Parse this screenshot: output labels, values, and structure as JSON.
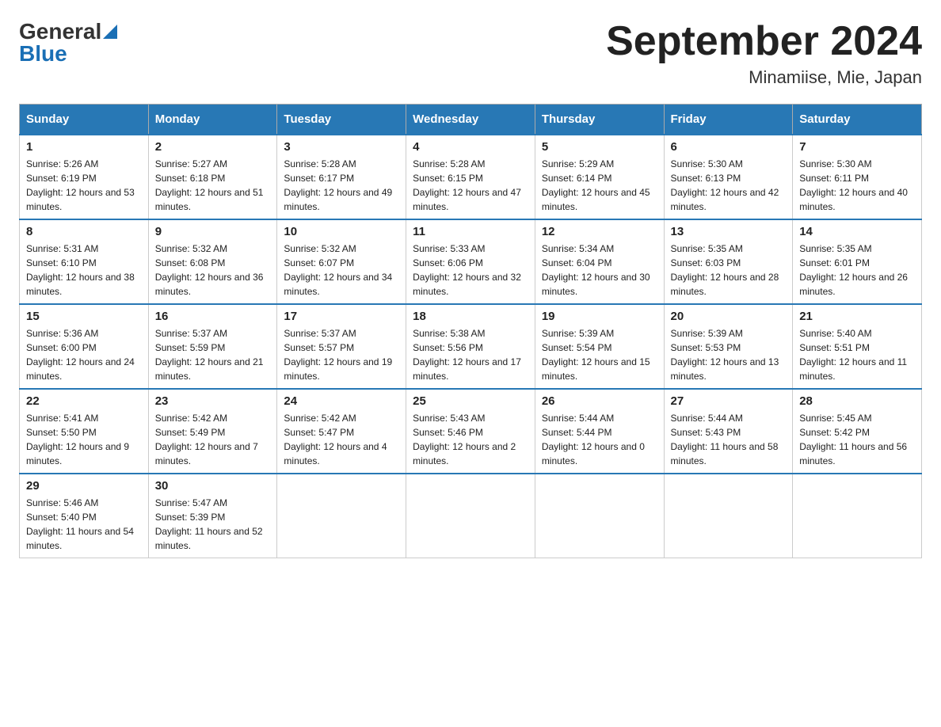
{
  "logo": {
    "text_general": "General",
    "text_blue": "Blue",
    "tagline": ""
  },
  "title": "September 2024",
  "subtitle": "Minamiise, Mie, Japan",
  "days_of_week": [
    "Sunday",
    "Monday",
    "Tuesday",
    "Wednesday",
    "Thursday",
    "Friday",
    "Saturday"
  ],
  "weeks": [
    [
      {
        "day": "1",
        "sunrise": "Sunrise: 5:26 AM",
        "sunset": "Sunset: 6:19 PM",
        "daylight": "Daylight: 12 hours and 53 minutes."
      },
      {
        "day": "2",
        "sunrise": "Sunrise: 5:27 AM",
        "sunset": "Sunset: 6:18 PM",
        "daylight": "Daylight: 12 hours and 51 minutes."
      },
      {
        "day": "3",
        "sunrise": "Sunrise: 5:28 AM",
        "sunset": "Sunset: 6:17 PM",
        "daylight": "Daylight: 12 hours and 49 minutes."
      },
      {
        "day": "4",
        "sunrise": "Sunrise: 5:28 AM",
        "sunset": "Sunset: 6:15 PM",
        "daylight": "Daylight: 12 hours and 47 minutes."
      },
      {
        "day": "5",
        "sunrise": "Sunrise: 5:29 AM",
        "sunset": "Sunset: 6:14 PM",
        "daylight": "Daylight: 12 hours and 45 minutes."
      },
      {
        "day": "6",
        "sunrise": "Sunrise: 5:30 AM",
        "sunset": "Sunset: 6:13 PM",
        "daylight": "Daylight: 12 hours and 42 minutes."
      },
      {
        "day": "7",
        "sunrise": "Sunrise: 5:30 AM",
        "sunset": "Sunset: 6:11 PM",
        "daylight": "Daylight: 12 hours and 40 minutes."
      }
    ],
    [
      {
        "day": "8",
        "sunrise": "Sunrise: 5:31 AM",
        "sunset": "Sunset: 6:10 PM",
        "daylight": "Daylight: 12 hours and 38 minutes."
      },
      {
        "day": "9",
        "sunrise": "Sunrise: 5:32 AM",
        "sunset": "Sunset: 6:08 PM",
        "daylight": "Daylight: 12 hours and 36 minutes."
      },
      {
        "day": "10",
        "sunrise": "Sunrise: 5:32 AM",
        "sunset": "Sunset: 6:07 PM",
        "daylight": "Daylight: 12 hours and 34 minutes."
      },
      {
        "day": "11",
        "sunrise": "Sunrise: 5:33 AM",
        "sunset": "Sunset: 6:06 PM",
        "daylight": "Daylight: 12 hours and 32 minutes."
      },
      {
        "day": "12",
        "sunrise": "Sunrise: 5:34 AM",
        "sunset": "Sunset: 6:04 PM",
        "daylight": "Daylight: 12 hours and 30 minutes."
      },
      {
        "day": "13",
        "sunrise": "Sunrise: 5:35 AM",
        "sunset": "Sunset: 6:03 PM",
        "daylight": "Daylight: 12 hours and 28 minutes."
      },
      {
        "day": "14",
        "sunrise": "Sunrise: 5:35 AM",
        "sunset": "Sunset: 6:01 PM",
        "daylight": "Daylight: 12 hours and 26 minutes."
      }
    ],
    [
      {
        "day": "15",
        "sunrise": "Sunrise: 5:36 AM",
        "sunset": "Sunset: 6:00 PM",
        "daylight": "Daylight: 12 hours and 24 minutes."
      },
      {
        "day": "16",
        "sunrise": "Sunrise: 5:37 AM",
        "sunset": "Sunset: 5:59 PM",
        "daylight": "Daylight: 12 hours and 21 minutes."
      },
      {
        "day": "17",
        "sunrise": "Sunrise: 5:37 AM",
        "sunset": "Sunset: 5:57 PM",
        "daylight": "Daylight: 12 hours and 19 minutes."
      },
      {
        "day": "18",
        "sunrise": "Sunrise: 5:38 AM",
        "sunset": "Sunset: 5:56 PM",
        "daylight": "Daylight: 12 hours and 17 minutes."
      },
      {
        "day": "19",
        "sunrise": "Sunrise: 5:39 AM",
        "sunset": "Sunset: 5:54 PM",
        "daylight": "Daylight: 12 hours and 15 minutes."
      },
      {
        "day": "20",
        "sunrise": "Sunrise: 5:39 AM",
        "sunset": "Sunset: 5:53 PM",
        "daylight": "Daylight: 12 hours and 13 minutes."
      },
      {
        "day": "21",
        "sunrise": "Sunrise: 5:40 AM",
        "sunset": "Sunset: 5:51 PM",
        "daylight": "Daylight: 12 hours and 11 minutes."
      }
    ],
    [
      {
        "day": "22",
        "sunrise": "Sunrise: 5:41 AM",
        "sunset": "Sunset: 5:50 PM",
        "daylight": "Daylight: 12 hours and 9 minutes."
      },
      {
        "day": "23",
        "sunrise": "Sunrise: 5:42 AM",
        "sunset": "Sunset: 5:49 PM",
        "daylight": "Daylight: 12 hours and 7 minutes."
      },
      {
        "day": "24",
        "sunrise": "Sunrise: 5:42 AM",
        "sunset": "Sunset: 5:47 PM",
        "daylight": "Daylight: 12 hours and 4 minutes."
      },
      {
        "day": "25",
        "sunrise": "Sunrise: 5:43 AM",
        "sunset": "Sunset: 5:46 PM",
        "daylight": "Daylight: 12 hours and 2 minutes."
      },
      {
        "day": "26",
        "sunrise": "Sunrise: 5:44 AM",
        "sunset": "Sunset: 5:44 PM",
        "daylight": "Daylight: 12 hours and 0 minutes."
      },
      {
        "day": "27",
        "sunrise": "Sunrise: 5:44 AM",
        "sunset": "Sunset: 5:43 PM",
        "daylight": "Daylight: 11 hours and 58 minutes."
      },
      {
        "day": "28",
        "sunrise": "Sunrise: 5:45 AM",
        "sunset": "Sunset: 5:42 PM",
        "daylight": "Daylight: 11 hours and 56 minutes."
      }
    ],
    [
      {
        "day": "29",
        "sunrise": "Sunrise: 5:46 AM",
        "sunset": "Sunset: 5:40 PM",
        "daylight": "Daylight: 11 hours and 54 minutes."
      },
      {
        "day": "30",
        "sunrise": "Sunrise: 5:47 AM",
        "sunset": "Sunset: 5:39 PM",
        "daylight": "Daylight: 11 hours and 52 minutes."
      },
      null,
      null,
      null,
      null,
      null
    ]
  ]
}
